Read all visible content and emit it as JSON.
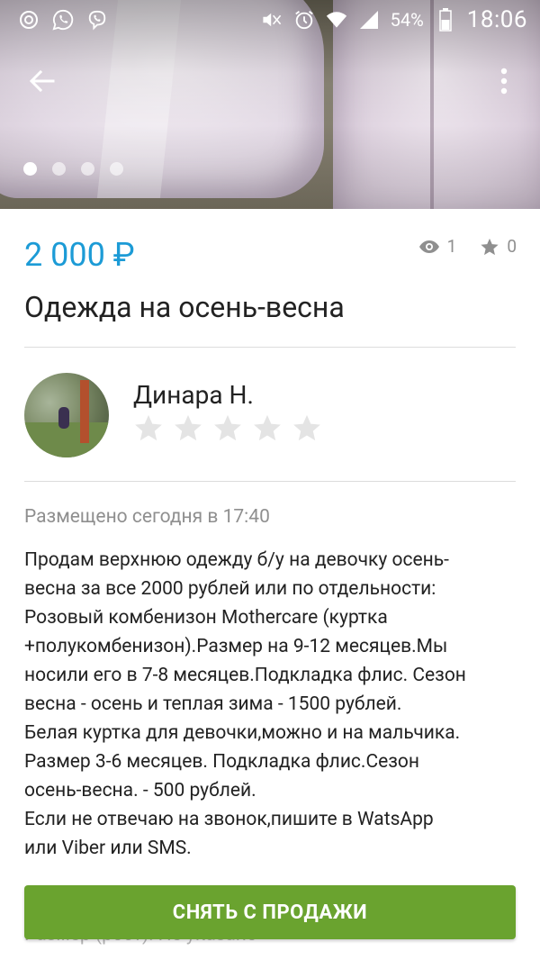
{
  "status_bar": {
    "battery": "54%",
    "time": "18:06",
    "icons": [
      "instagram-icon",
      "whatsapp-icon",
      "viber-icon",
      "mute-icon",
      "alarm-icon",
      "wifi-icon",
      "signal-icon",
      "battery-icon"
    ]
  },
  "gallery": {
    "pages": 4,
    "active_index": 0
  },
  "listing": {
    "price": "2 000 ₽",
    "views": "1",
    "favorites": "0",
    "title": "Одежда на осень-весна"
  },
  "seller": {
    "name": "Динара Н.",
    "rating": 0,
    "max_rating": 5
  },
  "posted": "Размещено сегодня в 17:40",
  "description": {
    "lines": [
      "Продам верхнюю одежду б/у на девочку осень-",
      "весна за все 2000 рублей или по отдельности:",
      "Розовый комбенизон Mothercare (куртка",
      "+полукомбенизон).Размер на 9-12 месяцев.Мы",
      "носили его в 7-8 месяцев.Подкладка флис. Сезон",
      "весна - осень и теплая зима - 1500 рублей.",
      "Белая куртка для девочки,можно и на мальчика.",
      "Размер 3-6 месяцев. Подкладка флис.Сезон",
      "осень-весна. - 500 рублей.",
      "Если не отвечаю на звонок,пишите в WatsApp",
      "или Viber или SMS."
    ]
  },
  "peek_text": "Размер (рост): Не указано",
  "action_button": "СНЯТЬ С ПРОДАЖИ",
  "colors": {
    "price": "#1c9bd6",
    "action": "#6aa32f",
    "muted": "#8f8f8f",
    "star_empty": "#e4e4e4"
  }
}
